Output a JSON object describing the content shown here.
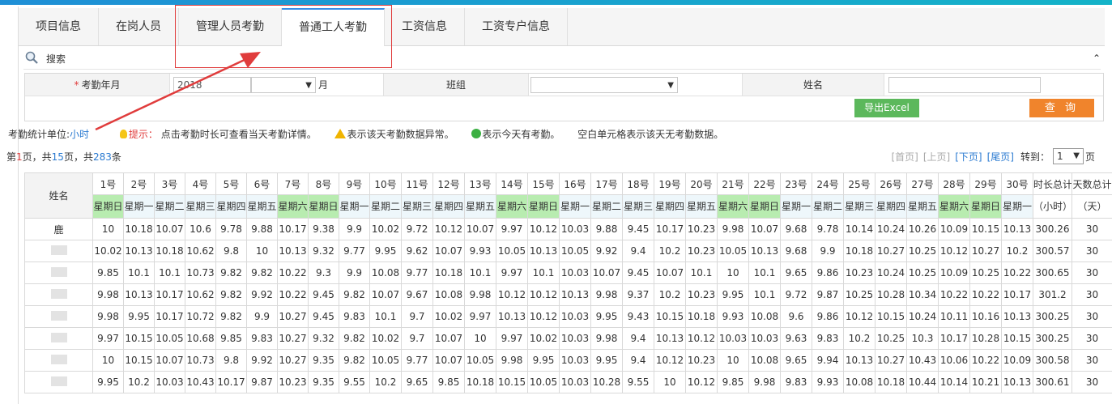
{
  "tabs": [
    "项目信息",
    "在岗人员",
    "管理人员考勤",
    "普通工人考勤",
    "工资信息",
    "工资专户信息"
  ],
  "active_tab": 3,
  "search": {
    "label": "搜索",
    "collapse": "⌃"
  },
  "form": {
    "year_month_label": "考勤年月",
    "required_mark": "*",
    "year_value": "2018",
    "month_suffix": "月",
    "team_label": "班组",
    "name_label": "姓名",
    "export_button": "导出Excel",
    "query_button": "查 询"
  },
  "hint": {
    "unit_prefix": "考勤统计单位:",
    "unit": "小时",
    "tip_label": "提示：",
    "tip_text": "点击考勤时长可查看当天考勤详情。",
    "warn_text": "表示该天考勤数据异常。",
    "ok_text": "表示今天有考勤。",
    "empty_text": "空白单元格表示该天无考勤数据。"
  },
  "pager": {
    "p1": "第",
    "page": "1",
    "p2": "页，共",
    "total_pages": "15",
    "p3": "页，共",
    "total_records": "283",
    "p4": "条",
    "first": "[首页]",
    "prev": "[上页]",
    "next": "[下页]",
    "last": "[尾页]",
    "goto": "转到：",
    "goto_value": "1",
    "goto_suffix": "页"
  },
  "table": {
    "name_header": "姓名",
    "total_hours_header": "时长总计",
    "total_hours_unit": "（小时）",
    "total_days_header": "天数总计",
    "total_days_unit": "（天）",
    "days": [
      "1号",
      "2号",
      "3号",
      "4号",
      "5号",
      "6号",
      "7号",
      "8号",
      "9号",
      "10号",
      "11号",
      "12号",
      "13号",
      "14号",
      "15号",
      "16号",
      "17号",
      "18号",
      "19号",
      "20号",
      "21号",
      "22号",
      "23号",
      "24号",
      "25号",
      "26号",
      "27号",
      "28号",
      "29号",
      "30号"
    ],
    "weekdays": [
      "星期日",
      "星期一",
      "星期二",
      "星期三",
      "星期四",
      "星期五",
      "星期六",
      "星期日",
      "星期一",
      "星期二",
      "星期三",
      "星期四",
      "星期五",
      "星期六",
      "星期日",
      "星期一",
      "星期二",
      "星期三",
      "星期四",
      "星期五",
      "星期六",
      "星期日",
      "星期一",
      "星期二",
      "星期三",
      "星期四",
      "星期五",
      "星期六",
      "星期日",
      "星期一"
    ],
    "weekend_color": "#b8ecb0",
    "weekday_color": "#eef7fb",
    "rows": [
      {
        "name": "鹿",
        "values": [
          "10",
          "10.18",
          "10.07",
          "10.6",
          "9.78",
          "9.88",
          "10.17",
          "9.38",
          "9.9",
          "10.02",
          "9.72",
          "10.12",
          "10.07",
          "9.97",
          "10.12",
          "10.03",
          "9.88",
          "9.45",
          "10.17",
          "10.23",
          "9.98",
          "10.07",
          "9.68",
          "9.78",
          "10.14",
          "10.24",
          "10.26",
          "10.09",
          "10.15",
          "10.13"
        ],
        "total_hours": "300.26",
        "total_days": "30"
      },
      {
        "name": "",
        "values": [
          "10.02",
          "10.13",
          "10.18",
          "10.62",
          "9.8",
          "10",
          "10.13",
          "9.32",
          "9.77",
          "9.95",
          "9.62",
          "10.07",
          "9.93",
          "10.05",
          "10.13",
          "10.05",
          "9.92",
          "9.4",
          "10.2",
          "10.23",
          "10.05",
          "10.13",
          "9.68",
          "9.9",
          "10.18",
          "10.27",
          "10.25",
          "10.12",
          "10.27",
          "10.2"
        ],
        "total_hours": "300.57",
        "total_days": "30"
      },
      {
        "name": "",
        "values": [
          "9.85",
          "10.1",
          "10.1",
          "10.73",
          "9.82",
          "9.82",
          "10.22",
          "9.3",
          "9.9",
          "10.08",
          "9.77",
          "10.18",
          "10.1",
          "9.97",
          "10.1",
          "10.03",
          "10.07",
          "9.45",
          "10.07",
          "10.1",
          "10",
          "10.1",
          "9.65",
          "9.86",
          "10.23",
          "10.24",
          "10.25",
          "10.09",
          "10.25",
          "10.22"
        ],
        "total_hours": "300.65",
        "total_days": "30"
      },
      {
        "name": "",
        "values": [
          "9.98",
          "10.13",
          "10.17",
          "10.62",
          "9.82",
          "9.92",
          "10.22",
          "9.45",
          "9.82",
          "10.07",
          "9.67",
          "10.08",
          "9.98",
          "10.12",
          "10.12",
          "10.13",
          "9.98",
          "9.37",
          "10.2",
          "10.23",
          "9.95",
          "10.1",
          "9.72",
          "9.87",
          "10.25",
          "10.28",
          "10.34",
          "10.22",
          "10.22",
          "10.17"
        ],
        "total_hours": "301.2",
        "total_days": "30"
      },
      {
        "name": "",
        "values": [
          "9.98",
          "9.95",
          "10.17",
          "10.72",
          "9.82",
          "9.9",
          "10.27",
          "9.45",
          "9.83",
          "10.1",
          "9.7",
          "10.02",
          "9.97",
          "10.13",
          "10.12",
          "10.03",
          "9.95",
          "9.43",
          "10.15",
          "10.18",
          "9.93",
          "10.08",
          "9.6",
          "9.86",
          "10.12",
          "10.15",
          "10.24",
          "10.11",
          "10.16",
          "10.13"
        ],
        "total_hours": "300.25",
        "total_days": "30"
      },
      {
        "name": "",
        "values": [
          "9.97",
          "10.15",
          "10.05",
          "10.68",
          "9.85",
          "9.83",
          "10.27",
          "9.32",
          "9.82",
          "10.02",
          "9.7",
          "10.07",
          "10",
          "9.97",
          "10.02",
          "10.03",
          "9.98",
          "9.4",
          "10.13",
          "10.12",
          "10.03",
          "10.03",
          "9.63",
          "9.83",
          "10.2",
          "10.25",
          "10.3",
          "10.17",
          "10.28",
          "10.15"
        ],
        "total_hours": "300.25",
        "total_days": "30"
      },
      {
        "name": "",
        "values": [
          "10",
          "10.15",
          "10.07",
          "10.73",
          "9.8",
          "9.92",
          "10.27",
          "9.35",
          "9.82",
          "10.05",
          "9.77",
          "10.07",
          "10.05",
          "9.98",
          "9.95",
          "10.03",
          "9.95",
          "9.4",
          "10.12",
          "10.23",
          "10",
          "10.08",
          "9.65",
          "9.94",
          "10.13",
          "10.27",
          "10.43",
          "10.06",
          "10.22",
          "10.09"
        ],
        "total_hours": "300.58",
        "total_days": "30"
      },
      {
        "name": "",
        "values": [
          "9.95",
          "10.2",
          "10.03",
          "10.43",
          "10.17",
          "9.87",
          "10.23",
          "9.35",
          "9.55",
          "10.2",
          "9.65",
          "9.85",
          "10.18",
          "10.15",
          "10.05",
          "10.03",
          "10.28",
          "9.55",
          "10",
          "10.12",
          "9.85",
          "9.98",
          "9.83",
          "9.93",
          "10.08",
          "10.18",
          "10.44",
          "10.14",
          "10.21",
          "10.13"
        ],
        "total_hours": "300.61",
        "total_days": "30"
      }
    ]
  }
}
